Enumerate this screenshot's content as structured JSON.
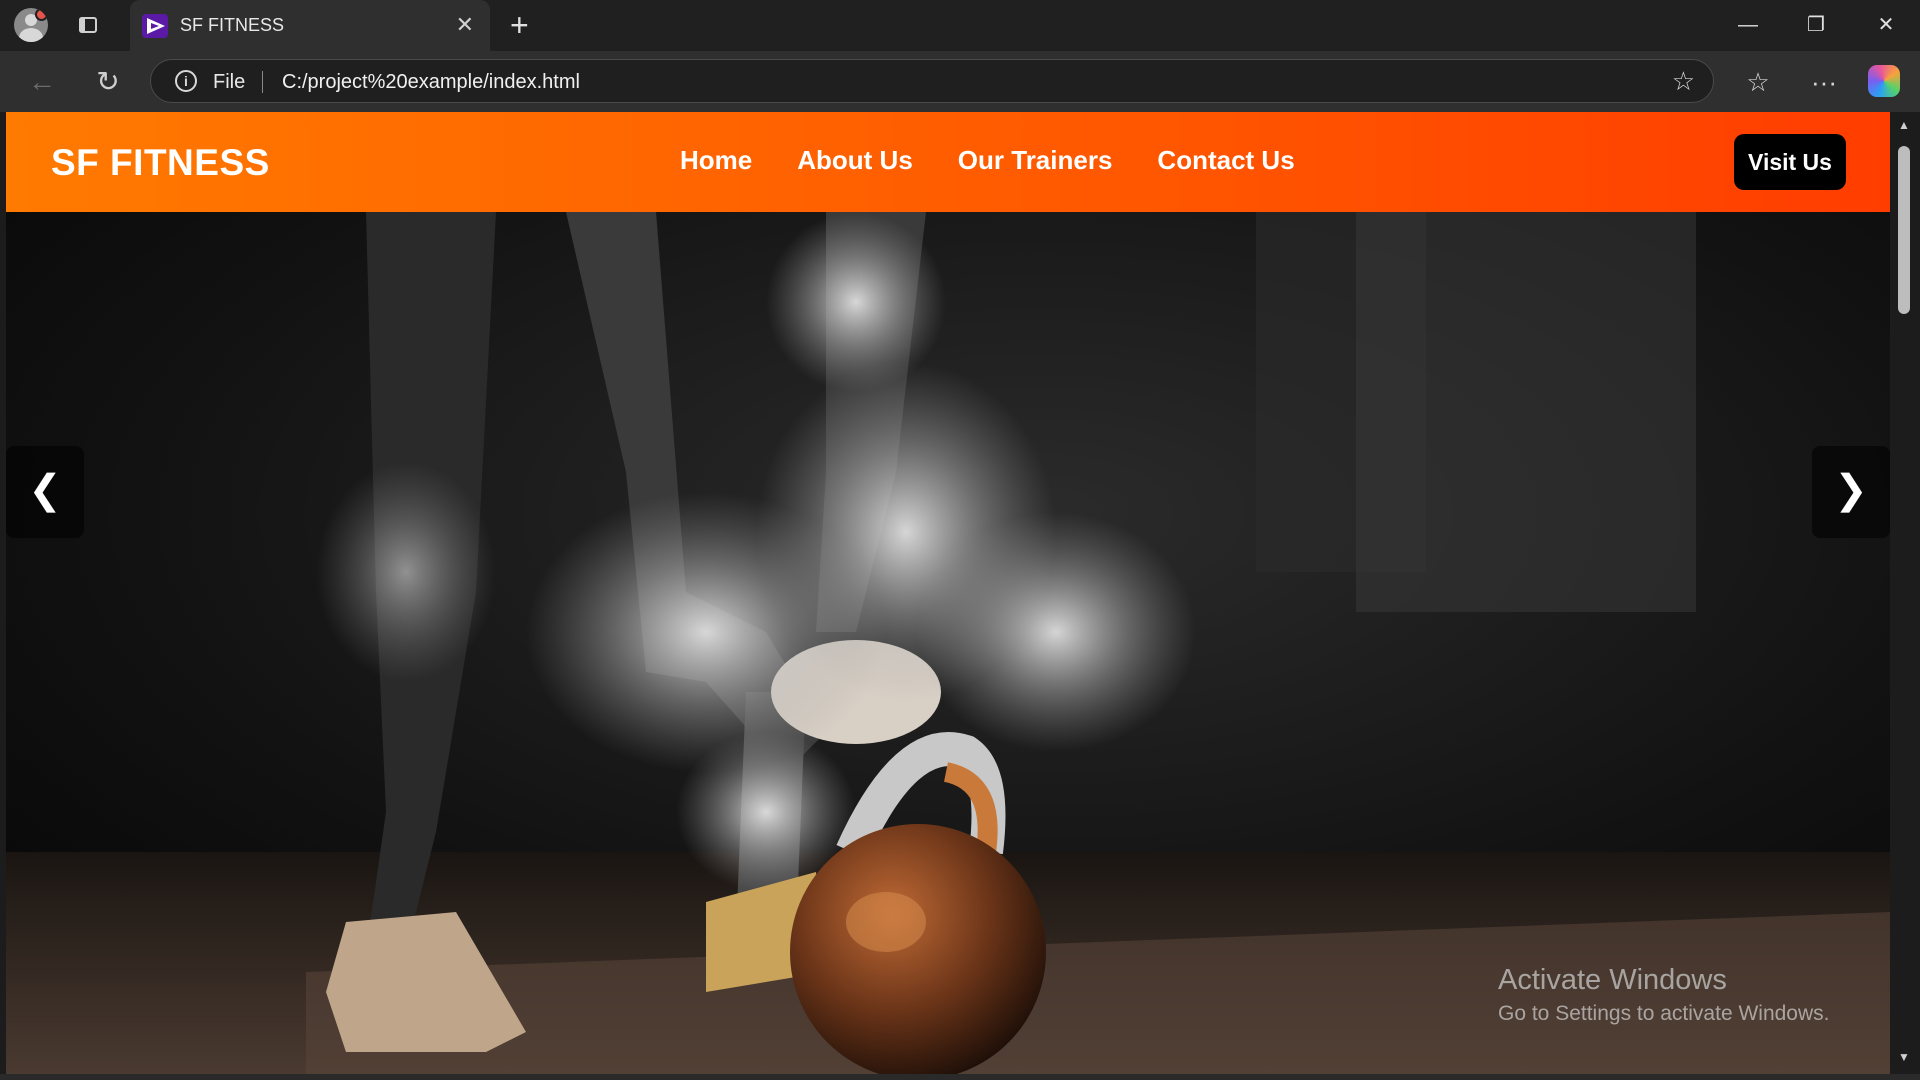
{
  "browser": {
    "tab": {
      "title": "SF FITNESS",
      "close": "✕",
      "favicon": "play-triangle-icon"
    },
    "newtab_label": "+",
    "window_controls": {
      "minimize": "—",
      "restore": "❐",
      "close": "✕"
    },
    "address": {
      "scheme_label": "File",
      "url": "C:/project%20example/index.html"
    },
    "icons": {
      "back": "←",
      "reload": "↻",
      "star": "☆",
      "favorites": "☆",
      "more": "···"
    }
  },
  "page": {
    "brand": "SF FITNESS",
    "menu": [
      "Home",
      "About Us",
      "Our Trainers",
      "Contact Us"
    ],
    "cta": "Visit Us",
    "carousel": {
      "prev": "❮",
      "next": "❯"
    },
    "accent_colors": {
      "nav_start": "#ff7a00",
      "nav_end": "#ff3d00",
      "cta_bg": "#000000"
    }
  },
  "watermark": {
    "title": "Activate Windows",
    "subtitle": "Go to Settings to activate Windows."
  }
}
